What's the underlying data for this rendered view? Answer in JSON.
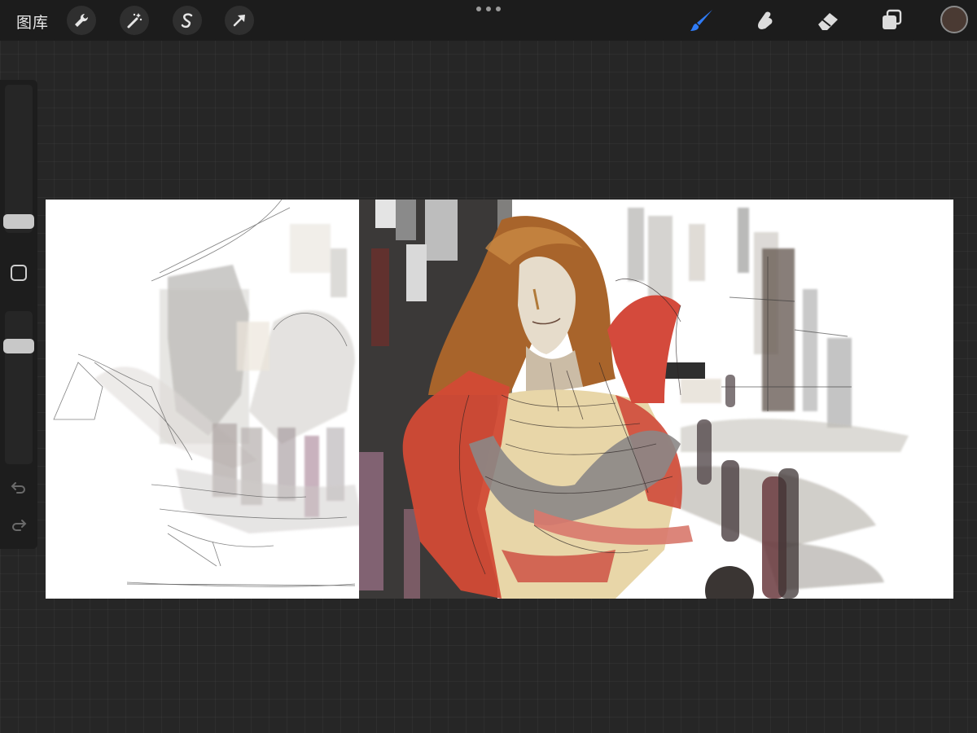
{
  "topbar": {
    "gallery_label": "图库",
    "left_tools": [
      "wrench-icon",
      "magic-wand-icon",
      "selection-s-icon",
      "transform-arrow-icon"
    ],
    "right_tools": [
      "brush-icon",
      "smudge-icon",
      "eraser-icon",
      "layers-icon"
    ],
    "active_tool": "brush",
    "current_color": "#4a3a33",
    "accent_color": "#2f7bf5"
  },
  "sidebar": {
    "controls": [
      "brush-size-slider",
      "modify-button",
      "opacity-slider",
      "undo-icon",
      "redo-icon"
    ]
  },
  "canvas": {
    "content": "painting"
  }
}
